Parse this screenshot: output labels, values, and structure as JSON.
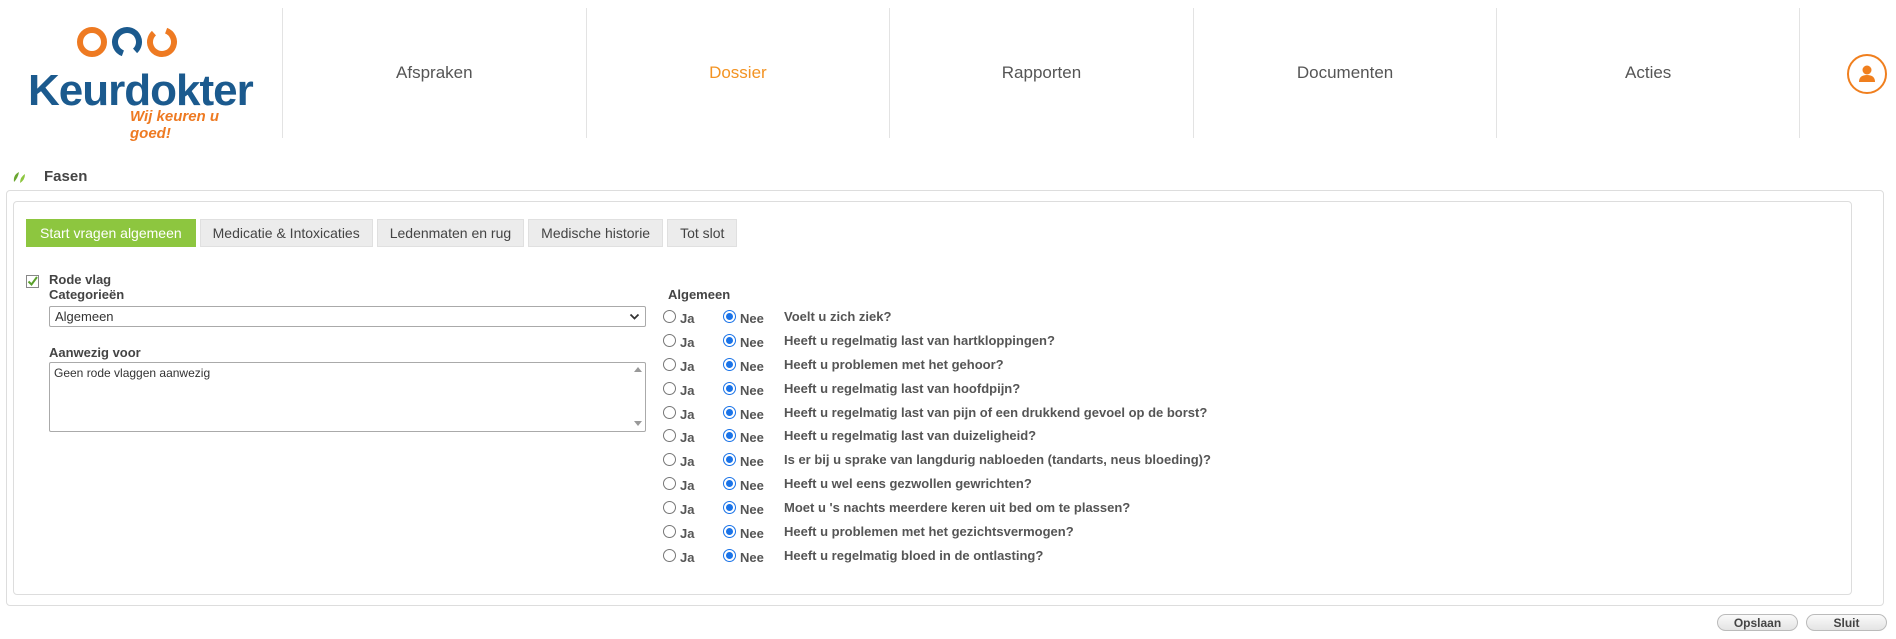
{
  "brand": {
    "name": "Keurdokter",
    "tagline": "Wij keuren u goed!",
    "colors": {
      "blue": "#1b5a8e",
      "orange": "#ee7a22"
    }
  },
  "nav": {
    "items": [
      {
        "label": "Afspraken"
      },
      {
        "label": "Dossier",
        "active": true
      },
      {
        "label": "Rapporten"
      },
      {
        "label": "Documenten"
      },
      {
        "label": "Acties"
      }
    ],
    "active_color": "#f39322",
    "profile_icon": "user-icon"
  },
  "section": {
    "title": "Fasen",
    "icon": "leaf-icon"
  },
  "tabs": [
    {
      "label": "Start vragen algemeen",
      "active": true
    },
    {
      "label": "Medicatie & Intoxicaties"
    },
    {
      "label": "Ledenmaten en rug"
    },
    {
      "label": "Medische historie"
    },
    {
      "label": "Tot slot"
    }
  ],
  "tab_active_color": "#8dc63f",
  "form": {
    "rode_vlag_label": "Rode vlag",
    "rode_vlag_checked": true,
    "categories_label": "Categorieën",
    "category_selected": "Algemeen",
    "aanwezig_label": "Aanwezig voor",
    "aanwezig_value": "Geen rode vlaggen aanwezig"
  },
  "questions": {
    "heading": "Algemeen",
    "ja_label": "Ja",
    "nee_label": "Nee",
    "items": [
      {
        "text": "Voelt u zich ziek?",
        "answer": "Nee"
      },
      {
        "text": "Heeft u regelmatig last van hartkloppingen?",
        "answer": "Nee"
      },
      {
        "text": "Heeft u problemen met het gehoor?",
        "answer": "Nee"
      },
      {
        "text": "Heeft u regelmatig last van hoofdpijn?",
        "answer": "Nee"
      },
      {
        "text": "Heeft u regelmatig last van pijn of een drukkend gevoel op de borst?",
        "answer": "Nee"
      },
      {
        "text": "Heeft u regelmatig last van duizeligheid?",
        "answer": "Nee"
      },
      {
        "text": "Is er bij u sprake van langdurig nabloeden (tandarts, neus bloeding)?",
        "answer": "Nee"
      },
      {
        "text": "Heeft u wel eens gezwollen gewrichten?",
        "answer": "Nee"
      },
      {
        "text": "Moet u 's nachts meerdere keren uit bed om te plassen?",
        "answer": "Nee"
      },
      {
        "text": "Heeft u problemen met het gezichtsvermogen?",
        "answer": "Nee"
      },
      {
        "text": "Heeft u regelmatig bloed in de ontlasting?",
        "answer": "Nee"
      }
    ]
  },
  "footer": {
    "save_label": "Opslaan",
    "close_label": "Sluit"
  }
}
